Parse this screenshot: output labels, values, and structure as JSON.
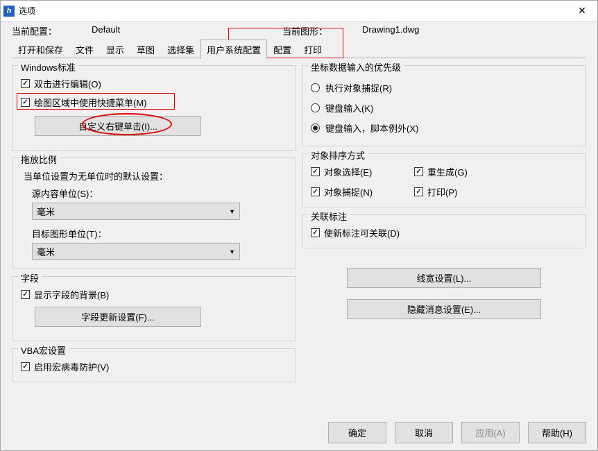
{
  "window": {
    "title": "选项"
  },
  "config": {
    "current_config_label": "当前配置：",
    "current_config_value": "Default",
    "current_drawing_label": "当前图形：",
    "current_drawing_value": "Drawing1.dwg"
  },
  "tabs": [
    "打开和保存",
    "文件",
    "显示",
    "草图",
    "选择集",
    "用户系统配置",
    "配置",
    "打印"
  ],
  "active_tab_index": 5,
  "windows_std": {
    "title": "Windows标准",
    "dblclick_edit": "双击进行编辑(O)",
    "shortcut_menu": "绘图区域中使用快捷菜单(M)",
    "custom_rclick": "自定义右键单击(I)..."
  },
  "drag_scale": {
    "title": "拖放比例",
    "desc": "当单位设置为无单位时的默认设置：",
    "source_label": "源内容单位(S)：",
    "source_value": "毫米",
    "target_label": "目标图形单位(T)：",
    "target_value": "毫米"
  },
  "fields": {
    "title": "字段",
    "show_bg": "显示字段的背景(B)",
    "update_settings": "字段更新设置(F)..."
  },
  "vba": {
    "title": "VBA宏设置",
    "virus_protect": "启用宏病毒防护(V)"
  },
  "coord_priority": {
    "title": "坐标数据输入的优先级",
    "opt1": "执行对象捕捉(R)",
    "opt2": "键盘输入(K)",
    "opt3": "键盘输入，脚本例外(X)"
  },
  "obj_sort": {
    "title": "对象排序方式",
    "select": "对象选择(E)",
    "regen": "重生成(G)",
    "osnap": "对象捕捉(N)",
    "print": "打印(P)"
  },
  "assoc_dim": {
    "title": "关联标注",
    "make_assoc": "使新标注可关联(D)"
  },
  "buttons_right": {
    "lineweight": "线宽设置(L)...",
    "hidden_msg": "隐藏消息设置(E)..."
  },
  "footer": {
    "ok": "确定",
    "cancel": "取消",
    "apply": "应用(A)",
    "help": "帮助(H)"
  }
}
